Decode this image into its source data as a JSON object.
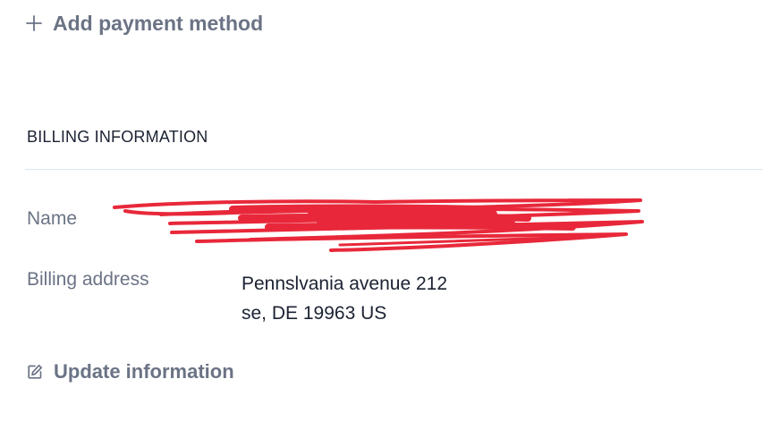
{
  "payment": {
    "add_label": "Add payment method",
    "add_icon": "plus-icon"
  },
  "billing": {
    "section_title": "BILLING INFORMATION",
    "name_label": "Name",
    "name_value": "",
    "address_label": "Billing address",
    "address_line1": "Pennslvania avenue 212",
    "address_line2": "se, DE 19963 US",
    "update_label": "Update information",
    "update_icon": "edit-icon"
  },
  "colors": {
    "muted_text": "#6b7385",
    "primary_text": "#1b2232",
    "divider": "#dbe6ee",
    "redaction": "#e8283a"
  }
}
